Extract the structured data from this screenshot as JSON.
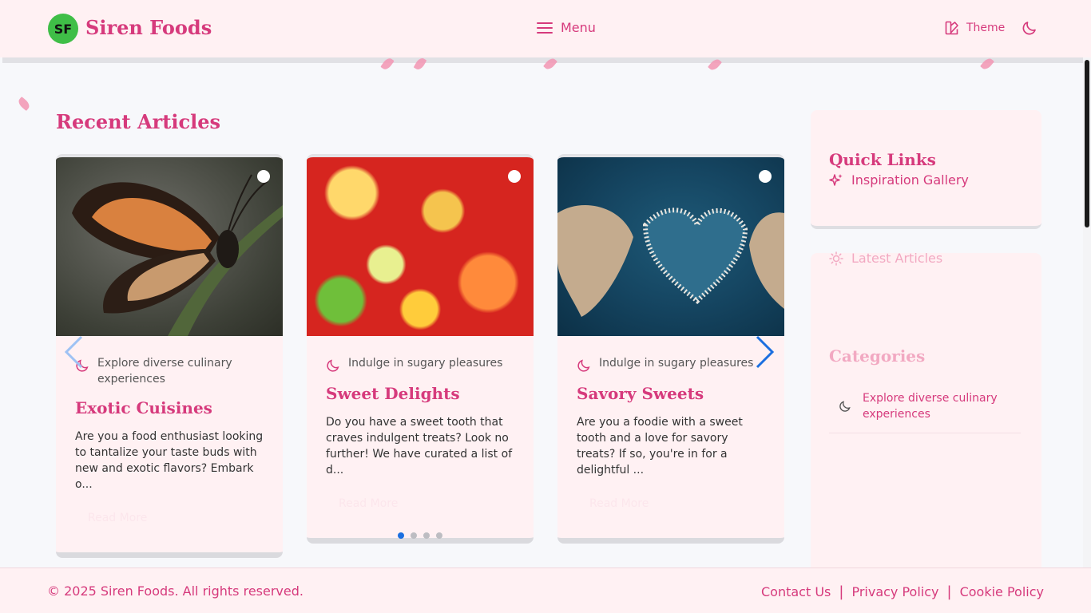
{
  "header": {
    "logo_initials": "SF",
    "brand": "Siren Foods",
    "menu_label": "Menu",
    "theme_label": "Theme"
  },
  "main": {
    "section_title": "Recent Articles",
    "cards": [
      {
        "tag": "Explore diverse culinary experiences",
        "title": "Exotic Cuisines",
        "excerpt": "Are you a food enthusiast looking to tantalize your taste buds with new and exotic flavors? Embark o...",
        "read_more": "Read More"
      },
      {
        "tag": "Indulge in sugary pleasures",
        "title": "Sweet Delights",
        "excerpt": "Do you have a sweet tooth that craves indulgent treats? Look no further! We have curated a list of d...",
        "read_more": "Read More"
      },
      {
        "tag": "Indulge in sugary pleasures",
        "title": "Savory Sweets",
        "excerpt": "Are you a foodie with a sweet tooth and a love for savory treats? If so, you're in for a delightful ...",
        "read_more": "Read More"
      }
    ],
    "carousel_dots": 4,
    "active_dot": 1
  },
  "sidebar": {
    "quick_links_title": "Quick Links",
    "quick_link": "Inspiration Gallery",
    "latest_articles": "Latest Articles",
    "categories_title": "Categories",
    "category_item": "Explore diverse culinary experiences"
  },
  "footer": {
    "copyright": "© 2025 Siren Foods. All rights reserved.",
    "links": [
      "Contact Us",
      "Privacy Policy",
      "Cookie Policy"
    ]
  },
  "colors": {
    "brand": "#d63a7c",
    "header_bg": "#fff1f3",
    "logo_bg": "#3fbe47",
    "carousel_active": "#1b6fe0"
  }
}
